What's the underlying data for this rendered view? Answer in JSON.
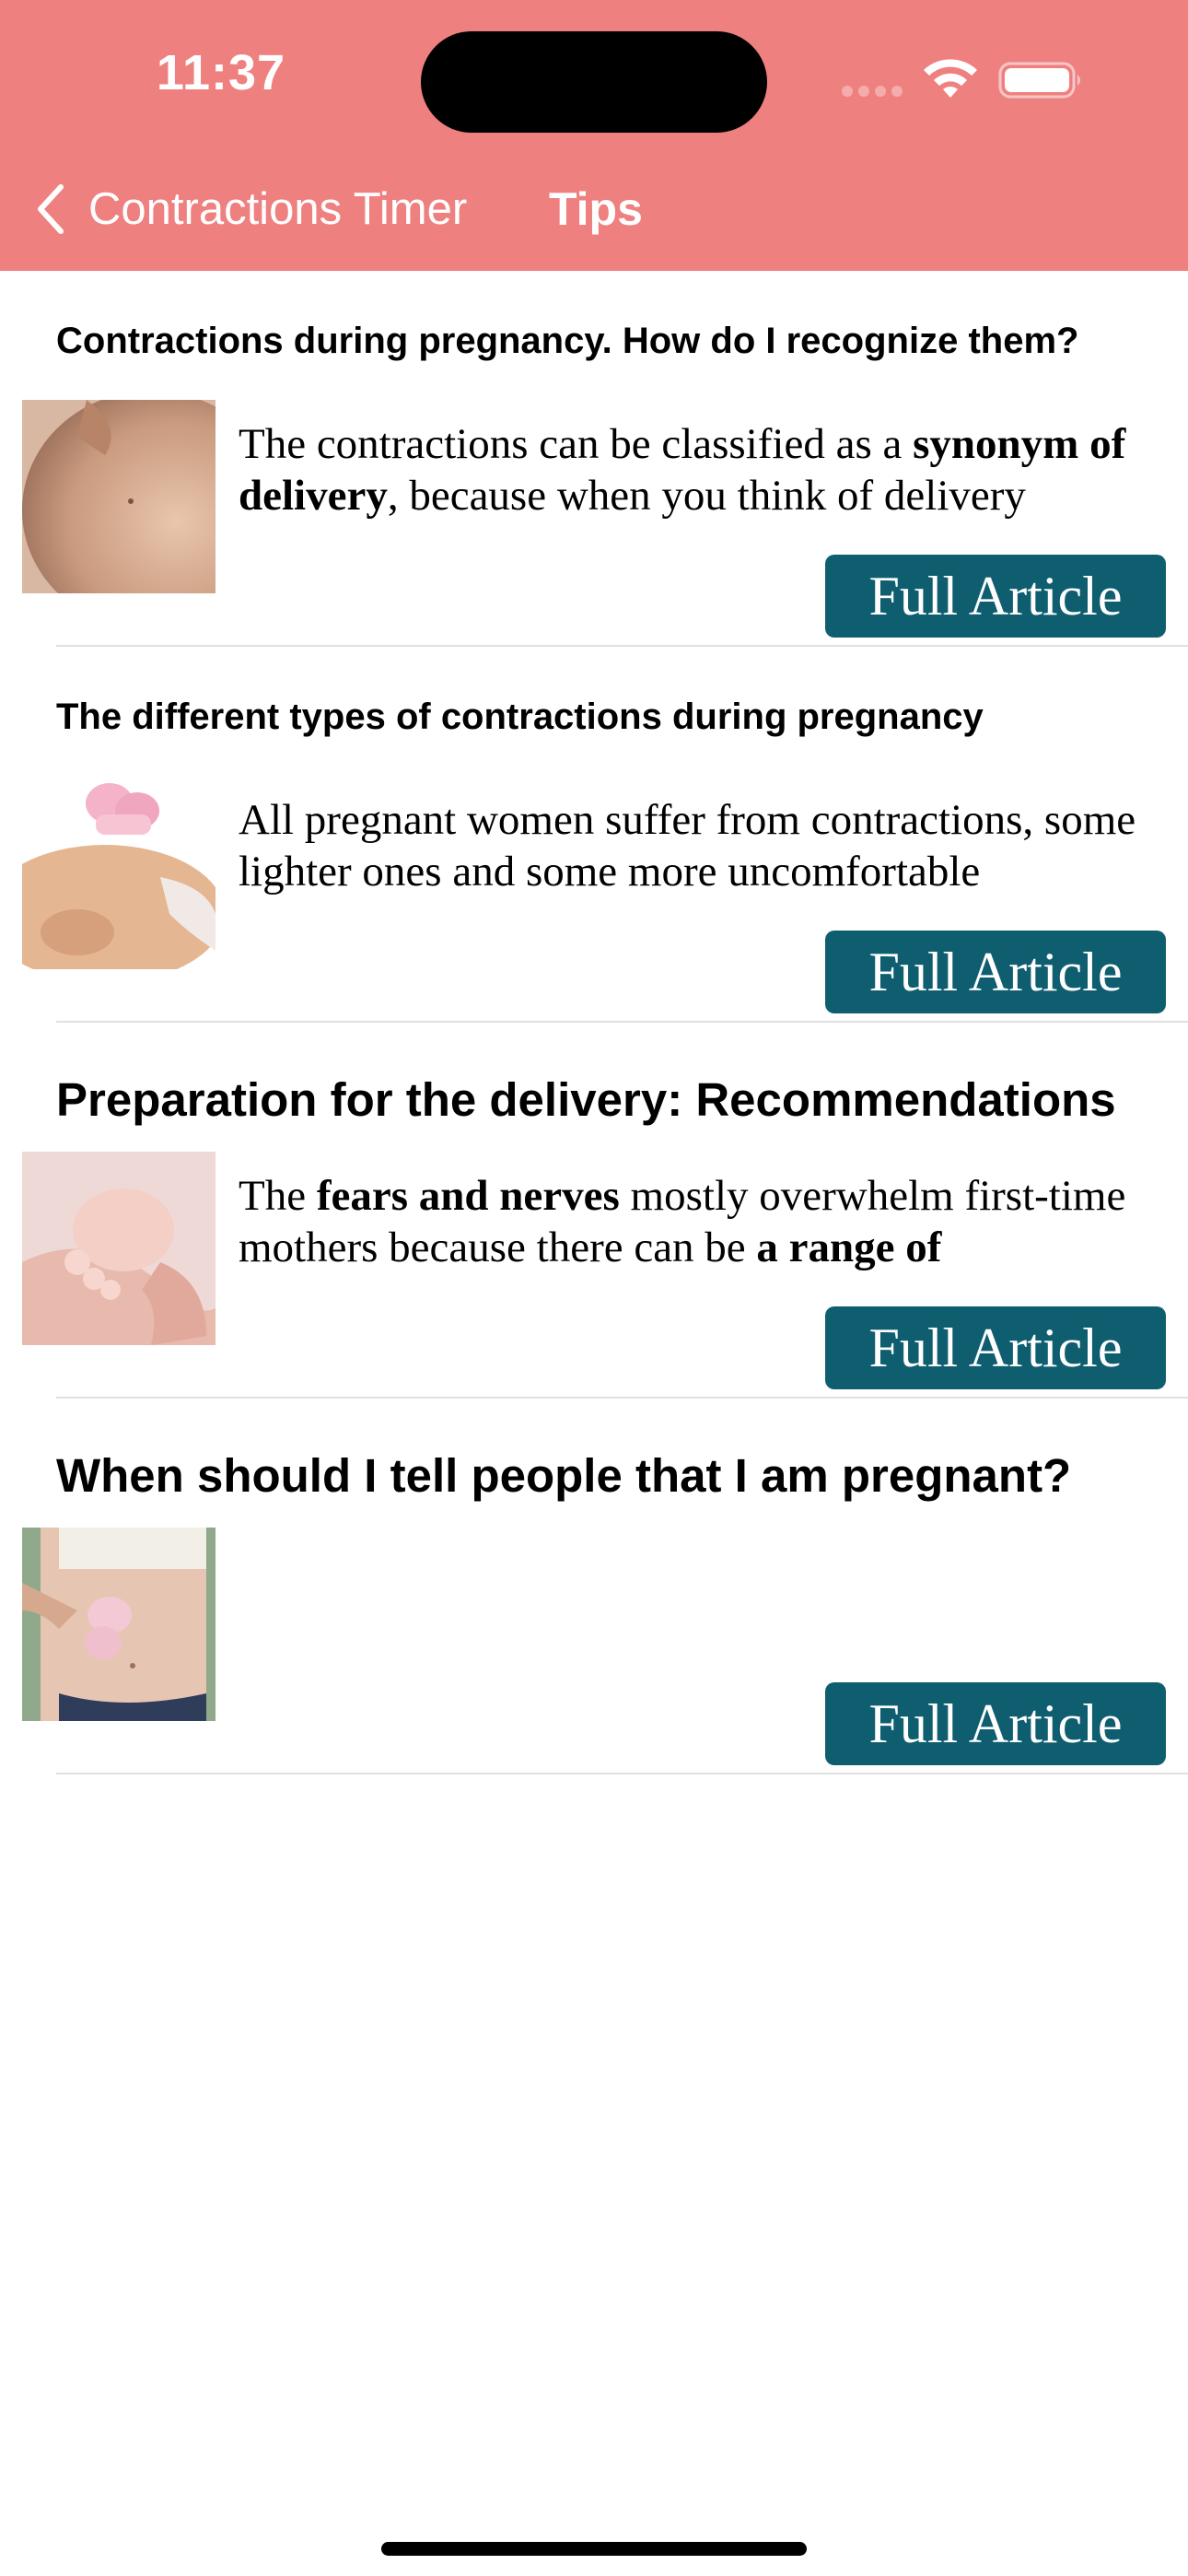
{
  "status_bar": {
    "time": "11:37"
  },
  "nav": {
    "back_label": "Contractions Timer",
    "title": "Tips"
  },
  "articles": [
    {
      "title": "Contractions during pregnancy. How do I recognize them?",
      "excerpt_parts": [
        {
          "text": "The contractions can be classified as a ",
          "bold": false
        },
        {
          "text": "synonym of delivery",
          "bold": true
        },
        {
          "text": ", because when you think of delivery",
          "bold": false
        }
      ],
      "button_label": "Full Article"
    },
    {
      "title": "The different types of contractions during pregnancy",
      "excerpt_parts": [
        {
          "text": "All pregnant women suffer from contractions, some lighter ones and some more uncomfortable",
          "bold": false
        }
      ],
      "button_label": "Full Article"
    },
    {
      "title": "Preparation for the delivery: Recommendations",
      "excerpt_parts": [
        {
          "text": "The ",
          "bold": false
        },
        {
          "text": "fears and nerves",
          "bold": true
        },
        {
          "text": " mostly overwhelm first-time mothers because there can be ",
          "bold": false
        },
        {
          "text": "a range of",
          "bold": true
        }
      ],
      "button_label": "Full Article"
    },
    {
      "title": "When should I tell people that I am pregnant?",
      "excerpt_parts": [],
      "button_label": "Full Article"
    }
  ],
  "colors": {
    "header_bg": "#ef8080",
    "button_bg": "#0f5e70",
    "divider": "#e0e0e0"
  },
  "icons": {
    "back": "chevron-left-icon",
    "wifi": "wifi-icon",
    "battery": "battery-icon",
    "signal": "cellular-signal-icon"
  }
}
